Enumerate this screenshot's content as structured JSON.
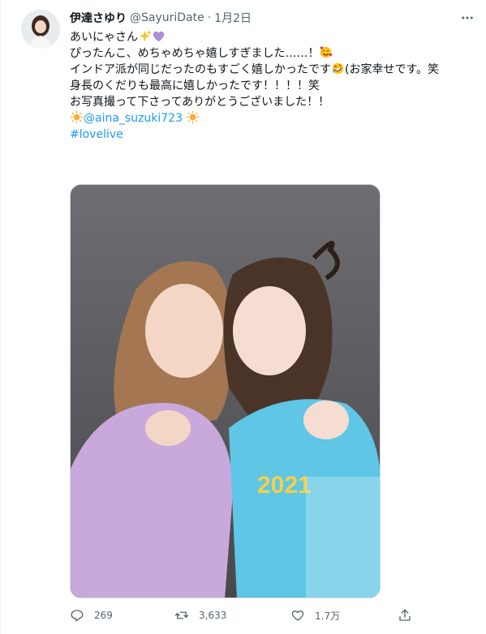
{
  "tweet": {
    "display_name": "伊達さゆり",
    "handle": "@SayuriDate",
    "separator": "·",
    "date": "1月2日",
    "lines": {
      "l1": "あいにゃさん",
      "l2": "ぴったんこ、めちゃめちゃ嬉しすぎました……！",
      "l3a": "インドア派が同じだったのもすごく嬉しかったです",
      "l3b": "(お家幸せです。笑",
      "l4": "身長のくだりも最高に嬉しかったです！！！！笑",
      "l5": "お写真撮って下さってありがとうございました！！",
      "mention": "@aina_suzuki723",
      "hashtag": "#lovelive"
    },
    "stats": {
      "replies": "269",
      "retweets": "3,633",
      "likes": "1.7万"
    }
  },
  "icons": {
    "more": "more-horizontal-icon",
    "reply": "reply-icon",
    "retweet": "retweet-icon",
    "like": "like-icon",
    "share": "share-icon"
  },
  "colors": {
    "link": "#1d9bf0",
    "secondary_text": "#536471",
    "primary_text": "#0f1419"
  }
}
